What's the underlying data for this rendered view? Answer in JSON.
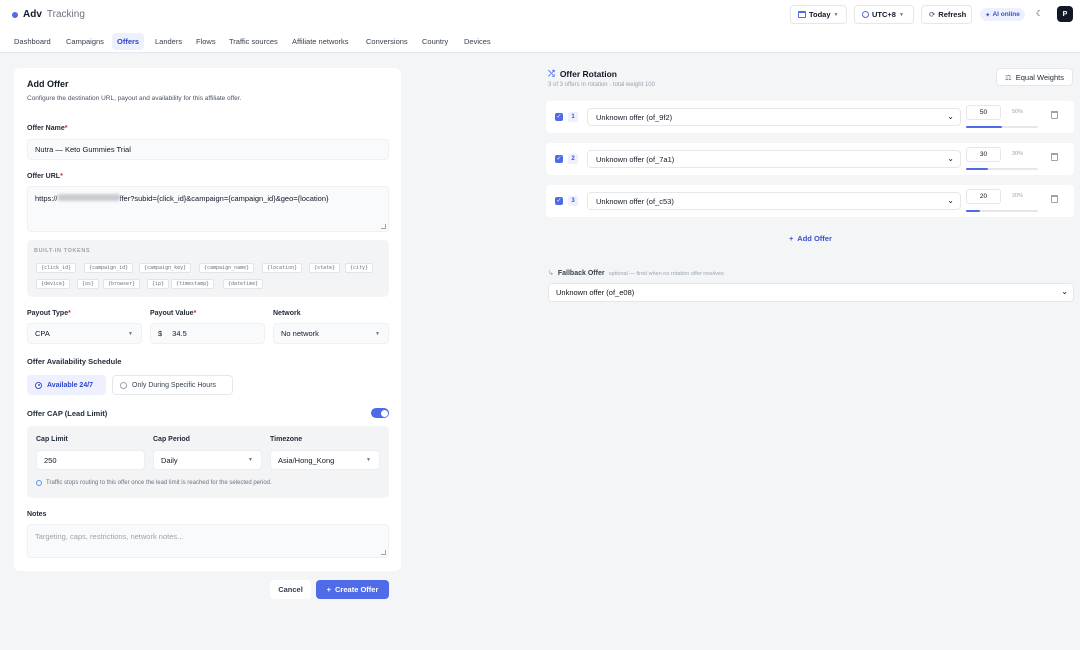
{
  "app": {
    "name": "Adv",
    "name_suffix": "Tracking"
  },
  "toolbar": {
    "date": "Today",
    "timezone": "UTC+8",
    "refresh": "Refresh",
    "ai_status": "AI online",
    "avatar": "P"
  },
  "nav": [
    "Dashboard",
    "Campaigns",
    "Offers",
    "Landers",
    "Flows",
    "Traffic sources",
    "Affiliate networks",
    "Conversions",
    "Country",
    "Devices"
  ],
  "nav_active": "Offers",
  "form": {
    "title": "Add Offer",
    "subtitle": "Configure the destination URL, payout and availability for this affiliate offer.",
    "offer_name_label": "Offer Name",
    "offer_name_value": "Nutra — Keto Gummies Trial",
    "offer_url_label": "Offer URL",
    "offer_url_prefix": "https://",
    "offer_url_suffix": "ffer?subid={click_id}&campaign={campaign_id}&geo={location}",
    "tokens_title": "BUILT-IN TOKENS",
    "tokens_row1": [
      "{click_id}",
      "{campaign_id}",
      "{campaign_key}",
      "{campaign_name}",
      "{location}",
      "{state}",
      "{city}"
    ],
    "tokens_row2": [
      "{device}",
      "{os}",
      "{browser}",
      "{ip}",
      "{timestamp}",
      "{datetime}"
    ],
    "payout_type_label": "Payout Type",
    "payout_type_value": "CPA",
    "payout_value_label": "Payout Value",
    "currency": "$",
    "payout_value": "34.5",
    "network_label": "Network",
    "network_value": "No network",
    "schedule_label": "Offer Availability Schedule",
    "schedule_opt1": "Available 24/7",
    "schedule_opt2": "Only During Specific Hours",
    "cap_label": "Offer CAP (Lead Limit)",
    "cap_enabled": true,
    "cap_limit_label": "Cap Limit",
    "cap_limit_value": "250",
    "cap_period_label": "Cap Period",
    "cap_period_value": "Daily",
    "tz_label": "Timezone",
    "tz_value": "Asia/Hong_Kong",
    "cap_info": "Traffic stops routing to this offer once the lead limit is reached for the selected period.",
    "notes_label": "Notes",
    "notes_placeholder": "Targeting, caps, restrictions, network notes...",
    "cancel": "Cancel",
    "create": "Create Offer"
  },
  "rotation": {
    "title": "Offer Rotation",
    "subtitle": "3 of 3 offers in rotation · total weight 100",
    "equal_weights": "Equal Weights",
    "rows": [
      {
        "idx": "1",
        "offer": "Unknown offer (of_9f2)",
        "weight": "50",
        "pct": "50%",
        "share": 0.5
      },
      {
        "idx": "2",
        "offer": "Unknown offer (of_7a1)",
        "weight": "30",
        "pct": "30%",
        "share": 0.3
      },
      {
        "idx": "3",
        "offer": "Unknown offer (of_c53)",
        "weight": "20",
        "pct": "20%",
        "share": 0.2
      }
    ],
    "add_offer": "Add Offer",
    "fallback_label": "Fallback Offer",
    "fallback_hint": "optional — fired when no rotation offer resolves",
    "fallback_value": "Unknown offer (of_e08)"
  },
  "colors": {
    "accent": "#4f6be8",
    "required": "#dc2626"
  }
}
